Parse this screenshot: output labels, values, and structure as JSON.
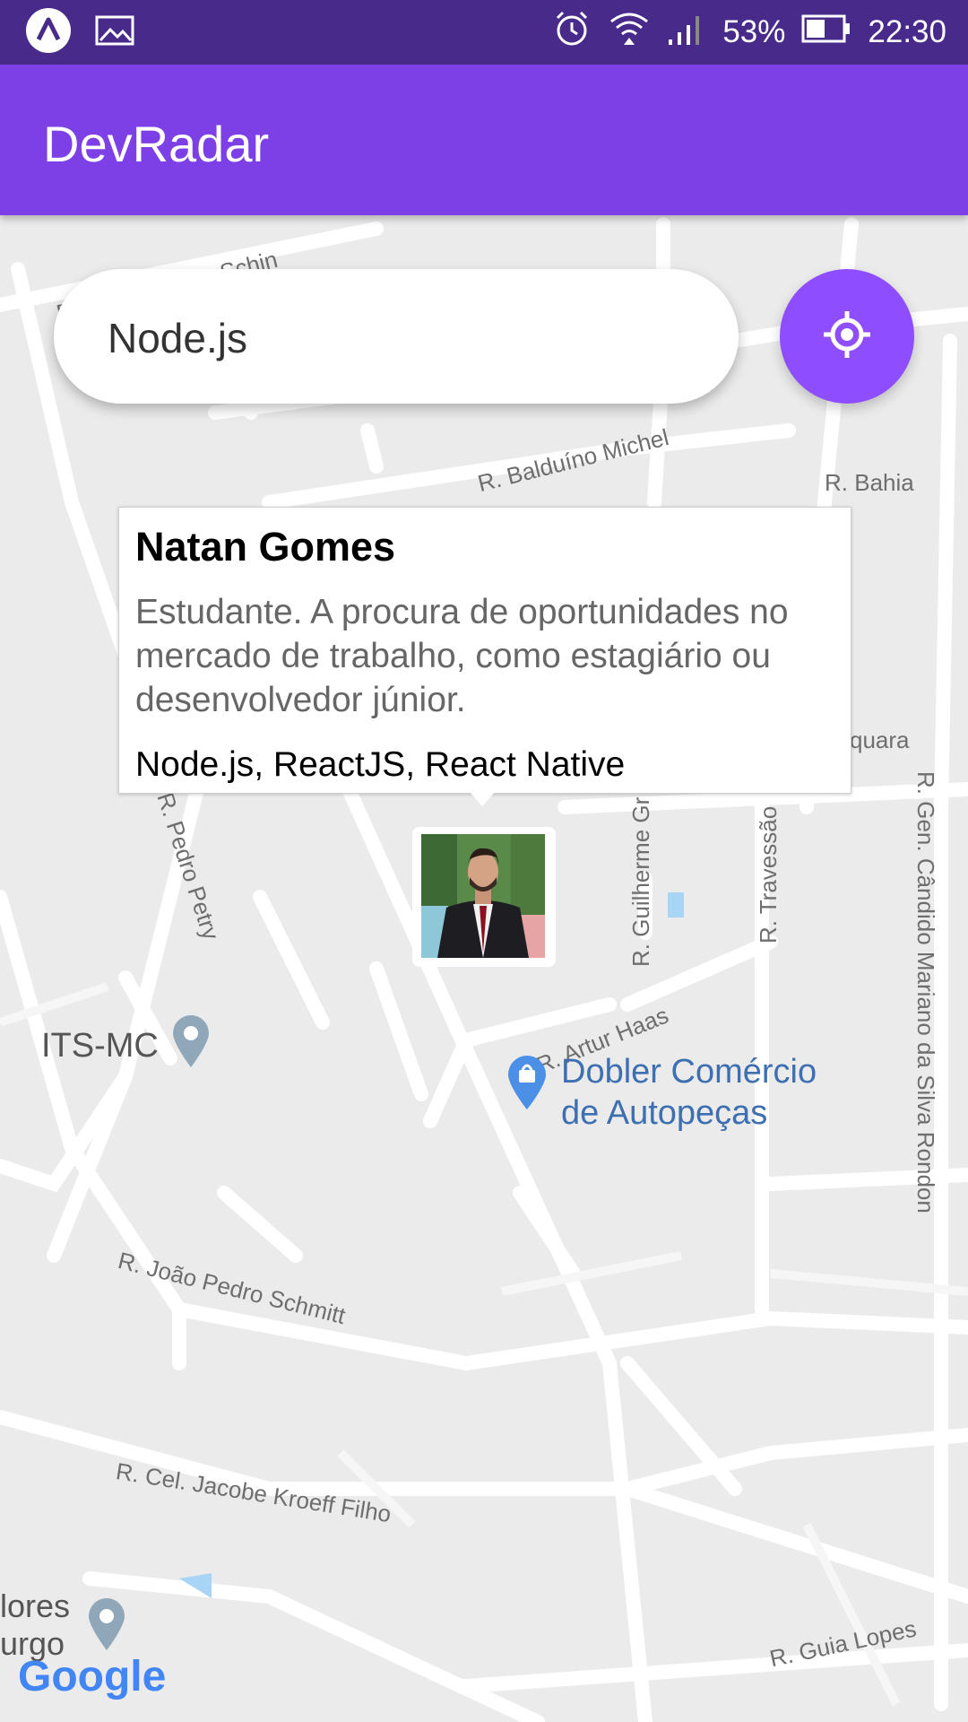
{
  "status_bar": {
    "battery": "53%",
    "time": "22:30"
  },
  "app_bar": {
    "title": "DevRadar"
  },
  "search": {
    "value": "Node.js"
  },
  "callout": {
    "name": "Natan Gomes",
    "bio": "Estudante. A procura de oportunidades no mercado de trabalho, como estagiário ou desenvolvedor júnior.",
    "techs": "Node.js, ReactJS, React Native"
  },
  "map": {
    "streets": {
      "wilhelm": "R. Carl Wilhelm Schin",
      "balduino": "R. Balduíno Michel",
      "bahia": "R. Bahia",
      "quara": "quara",
      "pedro_petry": "R. Pedro Petry",
      "guilherme": "R. Guilherme Gr",
      "travessao": "R. Travessão",
      "candido": "R. Gen. Cândido Mariano da Silva Rondon",
      "artur_haas": "R. Artur Haas",
      "joao_pedro": "R. João Pedro Schmitt",
      "jacobe": "R. Cel. Jacobe Kroeff Filho",
      "guia_lopes": "R. Guia Lopes"
    },
    "poi": {
      "its": "ITS-MC",
      "dobler_line1": "Dobler Comércio",
      "dobler_line2": "de Autopeças",
      "bottom_left_1": "lores",
      "bottom_left_2": "urgo"
    },
    "attribution": "Google"
  },
  "colors": {
    "status_bar": "#482a8a",
    "app_bar": "#7d40e7",
    "location_button": "#8e4dff"
  }
}
